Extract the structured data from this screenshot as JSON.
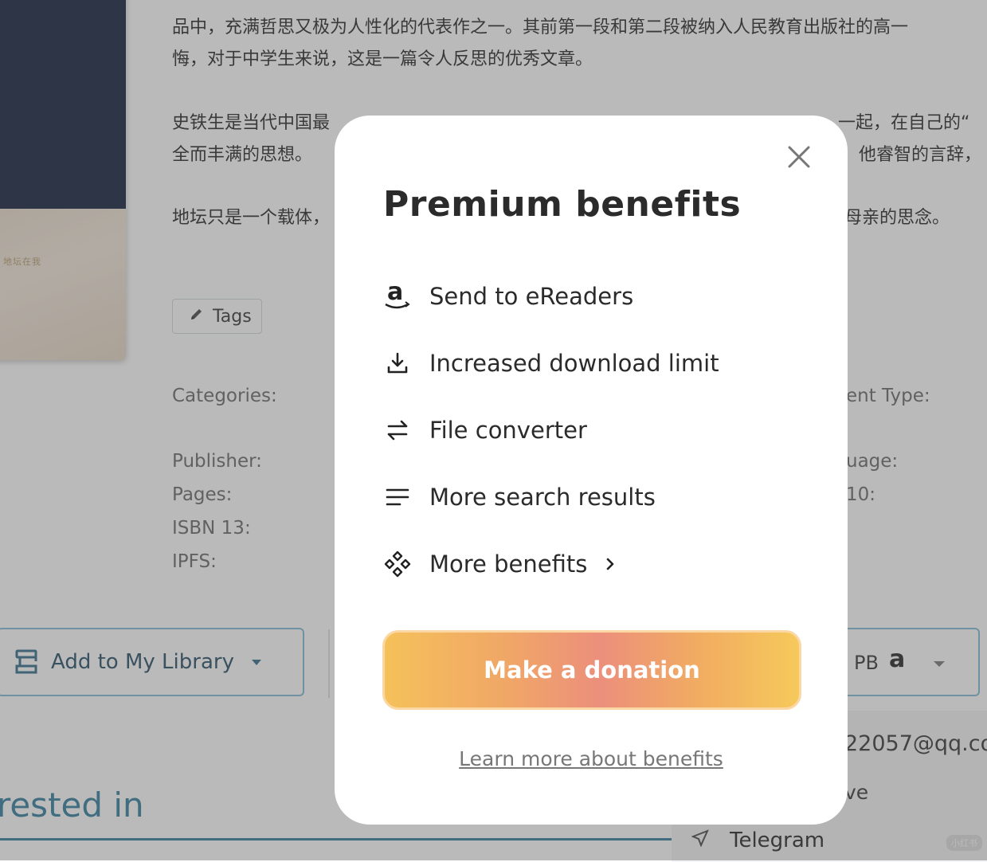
{
  "background": {
    "cover_text": "地坛在我",
    "description": [
      "品中，充满哲思又极为人性化的代表作之一。其前第一段和第二段被纳入人民教育出版社的高一",
      "悔，对于中学生来说，这是一篇令人反思的优秀文章。",
      "史铁生是当代中国最",
      "一起，在自己的“",
      "全而丰满的思想。",
      "他睿智的言辞，",
      "地坛只是一个载体，",
      "母亲的思念。"
    ],
    "tags_label": "Tags",
    "meta_labels": {
      "categories": "Categories:",
      "publisher": "Publisher:",
      "pages": "Pages:",
      "isbn13": "ISBN 13:",
      "ipfs": "IPFS:",
      "content_type": "ent Type:",
      "language": "uage:",
      "isbn10": "10:"
    },
    "add_library_label": "Add to My Library",
    "send_label": "PB",
    "send_amazon": "a",
    "email": "22057@qq.co",
    "save_label": "ve",
    "telegram_label": "Telegram",
    "interested_label": "rested in",
    "watermark": "小红书"
  },
  "modal": {
    "title": "Premium benefits",
    "benefits": [
      {
        "icon": "amazon-icon",
        "label": "Send to eReaders"
      },
      {
        "icon": "download-icon",
        "label": "Increased download limit"
      },
      {
        "icon": "convert-arrows-icon",
        "label": "File converter"
      },
      {
        "icon": "menu-lines-icon",
        "label": "More search results"
      },
      {
        "icon": "diamond-cluster-icon",
        "label": "More benefits"
      }
    ],
    "amazon_glyph": "a",
    "donate_label": "Make a donation",
    "learn_more": "Learn more about benefits"
  },
  "colors": {
    "accent_blue": "#2e7a9a",
    "donate_gradient": [
      "#f5c15a",
      "#ec8f7c",
      "#f6c95b"
    ],
    "overlay": "rgba(90,90,90,0.42)"
  }
}
